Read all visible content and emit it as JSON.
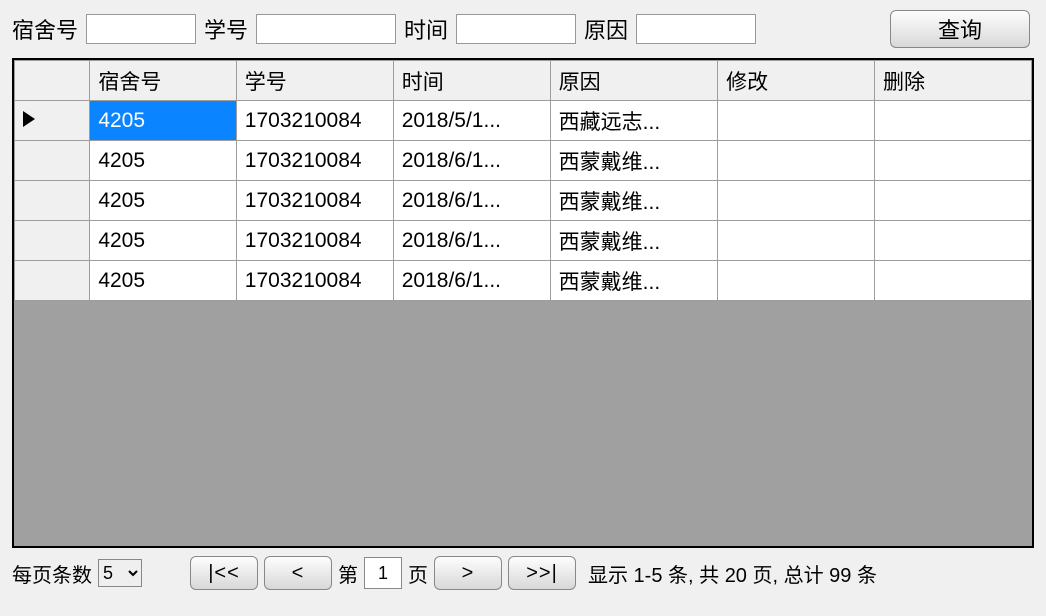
{
  "search": {
    "dorm_label": "宿舍号",
    "stu_label": "学号",
    "time_label": "时间",
    "reason_label": "原因",
    "query_btn": "查询",
    "dorm_value": "",
    "stu_value": "",
    "time_value": "",
    "reason_value": ""
  },
  "grid": {
    "headers": {
      "dorm": "宿舍号",
      "stu": "学号",
      "time": "时间",
      "reason": "原因",
      "modify": "修改",
      "delete": "删除"
    },
    "rows": [
      {
        "dorm": "4205",
        "stu": "1703210084",
        "time": "2018/5/1...",
        "reason": "西藏远志...",
        "modify": "",
        "delete": ""
      },
      {
        "dorm": "4205",
        "stu": "1703210084",
        "time": "2018/6/1...",
        "reason": "西蒙戴维...",
        "modify": "",
        "delete": ""
      },
      {
        "dorm": "4205",
        "stu": "1703210084",
        "time": "2018/6/1...",
        "reason": "西蒙戴维...",
        "modify": "",
        "delete": ""
      },
      {
        "dorm": "4205",
        "stu": "1703210084",
        "time": "2018/6/1...",
        "reason": "西蒙戴维...",
        "modify": "",
        "delete": ""
      },
      {
        "dorm": "4205",
        "stu": "1703210084",
        "time": "2018/6/1...",
        "reason": "西蒙戴维...",
        "modify": "",
        "delete": ""
      }
    ]
  },
  "pager": {
    "per_page_label": "每页条数",
    "per_page_value": "5",
    "first_label": "|<<",
    "prev_label": "<",
    "page_prefix": "第",
    "page_value": "1",
    "page_suffix": "页",
    "next_label": ">",
    "last_label": ">>|",
    "status": "显示 1-5  条, 共 20 页, 总计 99 条"
  }
}
